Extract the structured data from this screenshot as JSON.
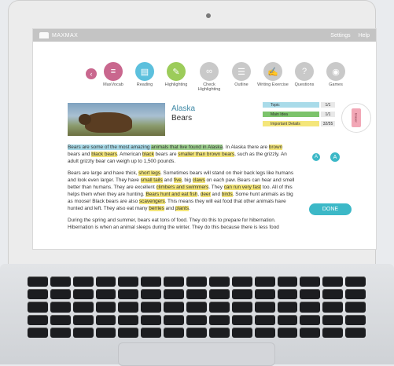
{
  "app": {
    "brand": "MAXMAX",
    "nav": [
      "Settings",
      "Help"
    ]
  },
  "toolbar": {
    "tools": [
      {
        "label": "MaxVocab",
        "icon": "vocab-icon",
        "color": "#c9678e"
      },
      {
        "label": "Reading",
        "icon": "book-icon",
        "color": "#5cc0dd"
      },
      {
        "label": "Highlighting",
        "icon": "highlighter-icon",
        "color": "#9ccc5a"
      },
      {
        "label": "Check Highlighting",
        "icon": "check-glasses-icon",
        "color": "#c9c9c9"
      },
      {
        "label": "Outline",
        "icon": "list-icon",
        "color": "#c9c9c9"
      },
      {
        "label": "Writing Exercise",
        "icon": "pencil-icon",
        "color": "#c9c9c9"
      },
      {
        "label": "Questions",
        "icon": "question-icon",
        "color": "#c9c9c9"
      },
      {
        "label": "Games",
        "icon": "gamepad-icon",
        "color": "#c9c9c9"
      }
    ]
  },
  "passage": {
    "title_line1": "Alaska",
    "title_line2": "Bears",
    "paragraphs": [
      [
        {
          "t": "Bears are some of the most amazing ",
          "h": "blue"
        },
        {
          "t": "animals that live found in Alaska",
          "h": "green"
        },
        {
          "t": ". In Alaska there are ",
          "h": ""
        },
        {
          "t": "brown",
          "h": "yellow"
        },
        {
          "t": " bears and ",
          "h": ""
        },
        {
          "t": "black bears",
          "h": "yellow"
        },
        {
          "t": ". American ",
          "h": ""
        },
        {
          "t": "black",
          "h": "yellow"
        },
        {
          "t": " bears are ",
          "h": ""
        },
        {
          "t": "smaller than brown bears",
          "h": "yellow"
        },
        {
          "t": ", such as the grizzly. An adult grizzly bear can weigh up to 1,500 pounds.",
          "h": ""
        }
      ],
      [
        {
          "t": "Bears are large and have thick, ",
          "h": ""
        },
        {
          "t": "short legs",
          "h": "yellow"
        },
        {
          "t": ". Sometimes bears will stand on their back legs like humans and look even larger. They have ",
          "h": ""
        },
        {
          "t": "small tails",
          "h": "yellow"
        },
        {
          "t": " and ",
          "h": ""
        },
        {
          "t": "five",
          "h": "yellow"
        },
        {
          "t": ", big ",
          "h": ""
        },
        {
          "t": "claws",
          "h": "yellow"
        },
        {
          "t": " on each paw. Bears can hear and smell better than humans. They are excellent ",
          "h": ""
        },
        {
          "t": "climbers and swimmers",
          "h": "yellow"
        },
        {
          "t": ". They ",
          "h": ""
        },
        {
          "t": "can run very fast",
          "h": "yellow"
        },
        {
          "t": " too. All of this helps them when they are hunting. ",
          "h": ""
        },
        {
          "t": "Bears hunt and eat fish",
          "h": "yellow"
        },
        {
          "t": ", ",
          "h": ""
        },
        {
          "t": "deer",
          "h": "yellow"
        },
        {
          "t": " and ",
          "h": ""
        },
        {
          "t": "birds",
          "h": "yellow"
        },
        {
          "t": ". Some hunt animals as big as moose! Black bears are also ",
          "h": ""
        },
        {
          "t": "scavengers",
          "h": "yellow"
        },
        {
          "t": ". This means they will eat food that other animals have hunted and left. They also eat many ",
          "h": ""
        },
        {
          "t": "berries",
          "h": "yellow"
        },
        {
          "t": " and ",
          "h": ""
        },
        {
          "t": "plants",
          "h": "yellow"
        },
        {
          "t": ".",
          "h": ""
        }
      ],
      [
        {
          "t": "During the spring and summer, bears eat tons of food. They do this to prepare for hibernation. Hibernation is when an animal sleeps during the winter. They do this because there is less food",
          "h": ""
        }
      ]
    ]
  },
  "tracker": {
    "rows": [
      {
        "label": "Topic",
        "count": "1/1",
        "color": "#a9dbe9"
      },
      {
        "label": "Main Idea",
        "count": "1/1",
        "color": "#7cc36b"
      },
      {
        "label": "Important Details",
        "count": "32/55",
        "color": "#f4e67a"
      }
    ],
    "eraser_label": "Eraser"
  },
  "text_size": {
    "small": "A",
    "large": "A"
  },
  "done_label": "DONE"
}
